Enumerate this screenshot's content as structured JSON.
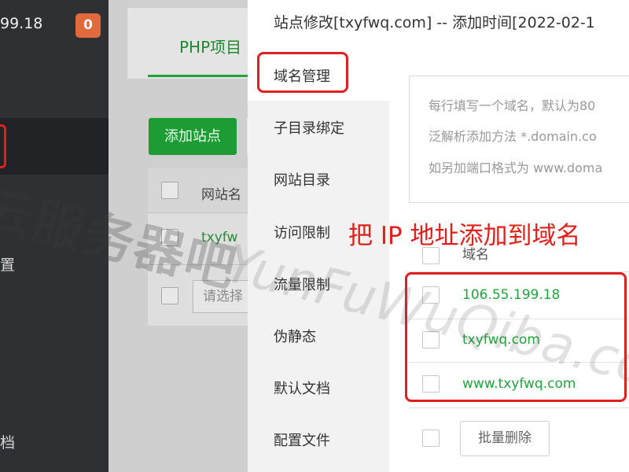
{
  "sidebar": {
    "ip_fragment": "99.18",
    "badge_count": "0",
    "fragment_1": "置",
    "fragment_2": "档"
  },
  "background_panel": {
    "tab_label": "PHP项目",
    "add_site_button": "添加站点",
    "column_site_name": "网站名",
    "site_name_partial": "txyfw",
    "select_placeholder": "请选择"
  },
  "modal": {
    "title": "站点修改[txyfwq.com] -- 添加时间[2022-02-1",
    "nav": [
      "域名管理",
      "子目录绑定",
      "网站目录",
      "访问限制",
      "流量限制",
      "伪静态",
      "默认文档",
      "配置文件"
    ],
    "active_nav_index": 0,
    "domain_input_hints": [
      "每行填写一个域名，默认为80",
      "泛解析添加方法 *.domain.co",
      "如另加端口格式为 www.doma"
    ],
    "annotation": "把 IP 地址添加到域名",
    "table_header_domain": "域名",
    "domains": [
      "106.55.199.18",
      "txyfwq.com",
      "www.txyfwq.com"
    ],
    "batch_delete_button": "批量删除"
  },
  "watermark": {
    "cn": "云服务器吧",
    "en": "YunFuWuQiba.com"
  },
  "colors": {
    "accent_green": "#20a53a",
    "annotation_red": "#e02020",
    "sidebar_bg": "#2f3033",
    "badge_orange": "#e06a3b"
  }
}
